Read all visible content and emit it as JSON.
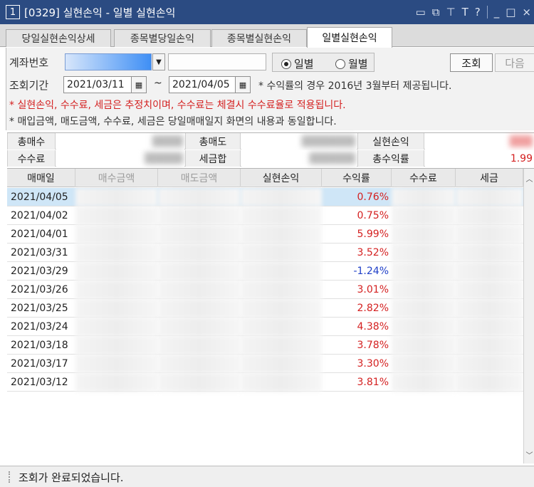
{
  "window": {
    "number": "1",
    "title": "[0329] 실현손익 - 일별 실현손익",
    "icons": [
      "window-icon",
      "tile-icon",
      "pin-icon",
      "text-icon",
      "help-icon",
      "minimize-icon",
      "maximize-icon",
      "close-icon"
    ],
    "help_glyph": "?",
    "text_glyph": "T"
  },
  "tabs": [
    {
      "label": "당일실현손익상세",
      "active": false
    },
    {
      "label": "종목별당일손익",
      "active": false
    },
    {
      "label": "종목별실현손익",
      "active": false
    },
    {
      "label": "일별실현손익",
      "active": true
    }
  ],
  "form": {
    "account_label": "계좌번호",
    "radio_daily": "일별",
    "radio_monthly": "월별",
    "radio_selected": "일별",
    "query_button": "조회",
    "next_button": "다음",
    "period_label": "조회기간",
    "date_from": "2021/03/11",
    "date_to": "2021/04/05",
    "tilde": "~",
    "note1": "* 수익률의 경우 2016년 3월부터 제공됩니다.",
    "note2": "* 실현손익, 수수료, 세금은 추정치이며, 수수료는 체결시 수수료율로 적용됩니다.",
    "note3": "* 매입금액, 매도금액, 수수료, 세금은 당일매매일지 화면의 내용과 동일합니다."
  },
  "summary": {
    "total_buy_label": "총매수",
    "total_sell_label": "총매도",
    "realized_label": "실현손익",
    "fee_label": "수수료",
    "tax_label": "세금합",
    "total_return_label": "총수익률",
    "total_return_value": "1.99"
  },
  "table": {
    "headers": [
      "매매일",
      "매수금액",
      "매도금액",
      "실현손익",
      "수익률",
      "수수료",
      "세금"
    ],
    "rows": [
      {
        "date": "2021/04/05",
        "rate": "0.76%"
      },
      {
        "date": "2021/04/02",
        "rate": "0.75%"
      },
      {
        "date": "2021/04/01",
        "rate": "5.99%"
      },
      {
        "date": "2021/03/31",
        "rate": "3.52%"
      },
      {
        "date": "2021/03/29",
        "rate": "-1.24%"
      },
      {
        "date": "2021/03/26",
        "rate": "3.01%"
      },
      {
        "date": "2021/03/25",
        "rate": "2.82%"
      },
      {
        "date": "2021/03/24",
        "rate": "4.38%"
      },
      {
        "date": "2021/03/18",
        "rate": "3.78%"
      },
      {
        "date": "2021/03/17",
        "rate": "3.30%"
      },
      {
        "date": "2021/03/12",
        "rate": "3.81%"
      }
    ],
    "selected_row": 0
  },
  "status": {
    "message": "조회가 완료되었습니다."
  },
  "colors": {
    "titlebar": "#2b4b82",
    "positive": "#d42020",
    "negative": "#2040c8",
    "selected_row": "#cfe6f7"
  }
}
